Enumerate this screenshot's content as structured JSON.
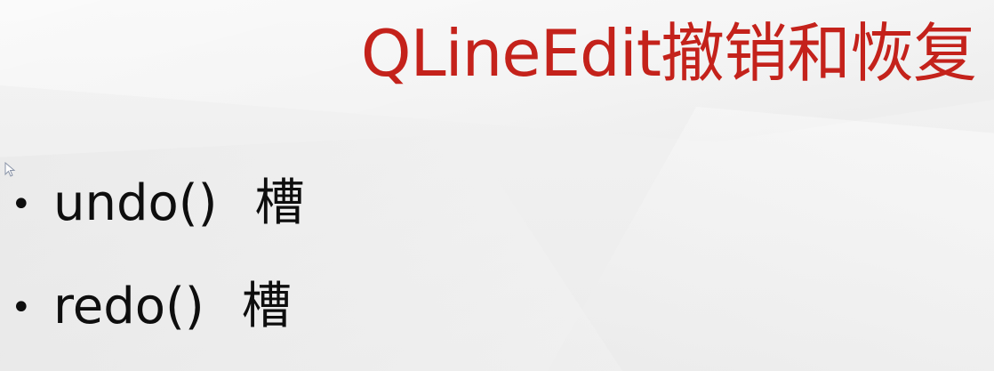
{
  "slide": {
    "title": "QLineEdit撤销和恢复",
    "colors": {
      "title": "#c4221b",
      "body_text": "#0e0e0e",
      "background": "#f0f0f0"
    },
    "bullets": [
      {
        "marker": "•",
        "method": "undo()",
        "kind": "槽"
      },
      {
        "marker": "•",
        "method": "redo()",
        "kind": "槽"
      }
    ],
    "cursor_icon": "mouse-pointer-icon"
  }
}
